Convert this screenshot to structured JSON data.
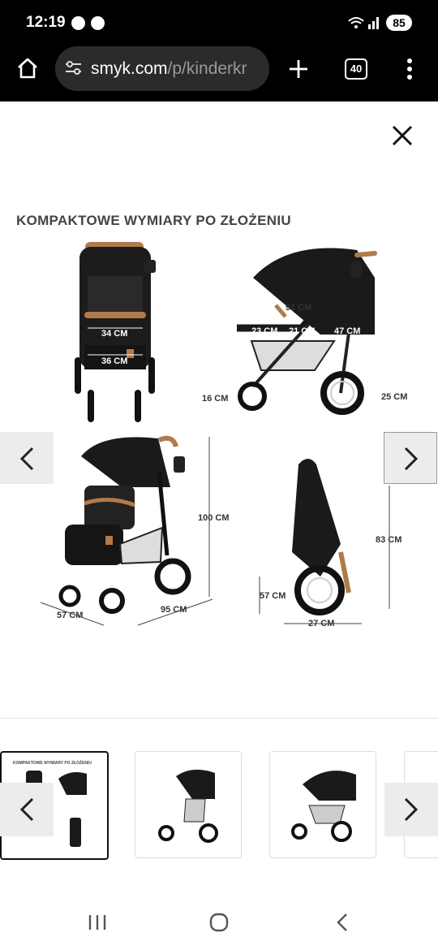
{
  "status_bar": {
    "time": "12:19",
    "battery": "85"
  },
  "browser": {
    "url_host": "smyk.com",
    "url_path": "/p/kinderkr",
    "tab_count": "40"
  },
  "gallery": {
    "title": "KOMPAKTOWE WYMIARY PO ZŁOŻENIU",
    "dimensions": {
      "seat_width": "34 CM",
      "footrest_width": "36 CM",
      "canopy_length": "91 CM",
      "seat_depth": "23 CM",
      "backrest": "21 CM",
      "top_length": "47 CM",
      "front_clearance": "16 CM",
      "rear_clearance": "25 CM",
      "height": "100 CM",
      "width": "57 CM",
      "length": "95 CM",
      "folded_height": "83 CM",
      "folded_depth": "57 CM",
      "folded_width": "27 CM"
    }
  },
  "thumbnails": {
    "title": "KOMPAKTOWE WYMIARY PO ZŁOŻENIU"
  },
  "colors": {
    "toolbar": "#000000",
    "url_pill": "#2b2b2b",
    "stroller": "#1a1a1a",
    "handle": "#b07a4a"
  }
}
